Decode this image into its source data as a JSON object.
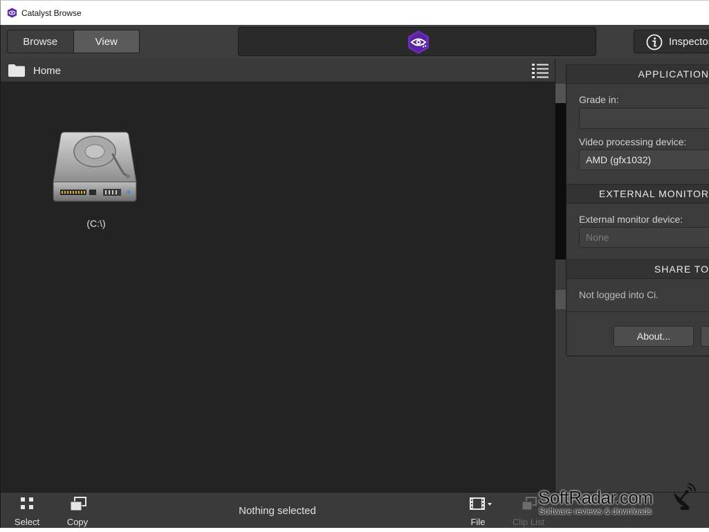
{
  "window": {
    "title": "Catalyst Browse"
  },
  "toolbar": {
    "browse_label": "Browse",
    "view_label": "View",
    "logo_icon": "catalyst-eye-logo-icon",
    "inspector_label": "Inspector"
  },
  "browser": {
    "path": "Home",
    "items": [
      {
        "label": "(C:\\)",
        "icon": "hard-drive-icon"
      }
    ]
  },
  "inspector": {
    "sections": {
      "application": "APPLICATION",
      "external_monitor": "EXTERNAL MONITOR",
      "share_to": "SHARE TO"
    },
    "grade_in": {
      "label": "Grade in:",
      "value": ""
    },
    "video_processing": {
      "label": "Video processing device:",
      "value": "AMD (gfx1032)"
    },
    "external_monitor_device": {
      "label": "External monitor device:",
      "value": "None"
    },
    "share_status": "Not logged into Ci.",
    "about_button": "About..."
  },
  "bottombar": {
    "select_label": "Select",
    "copy_label": "Copy",
    "status": "Nothing selected",
    "file_label": "File",
    "cliplist_label": "Clip List"
  },
  "watermark": {
    "title": "SoftRadar.com",
    "subtitle": "Software reviews & downloads"
  },
  "colors": {
    "accent_purple": "#6a2fb5",
    "panel_bg": "#3a3a3a",
    "browser_bg": "#232323"
  }
}
